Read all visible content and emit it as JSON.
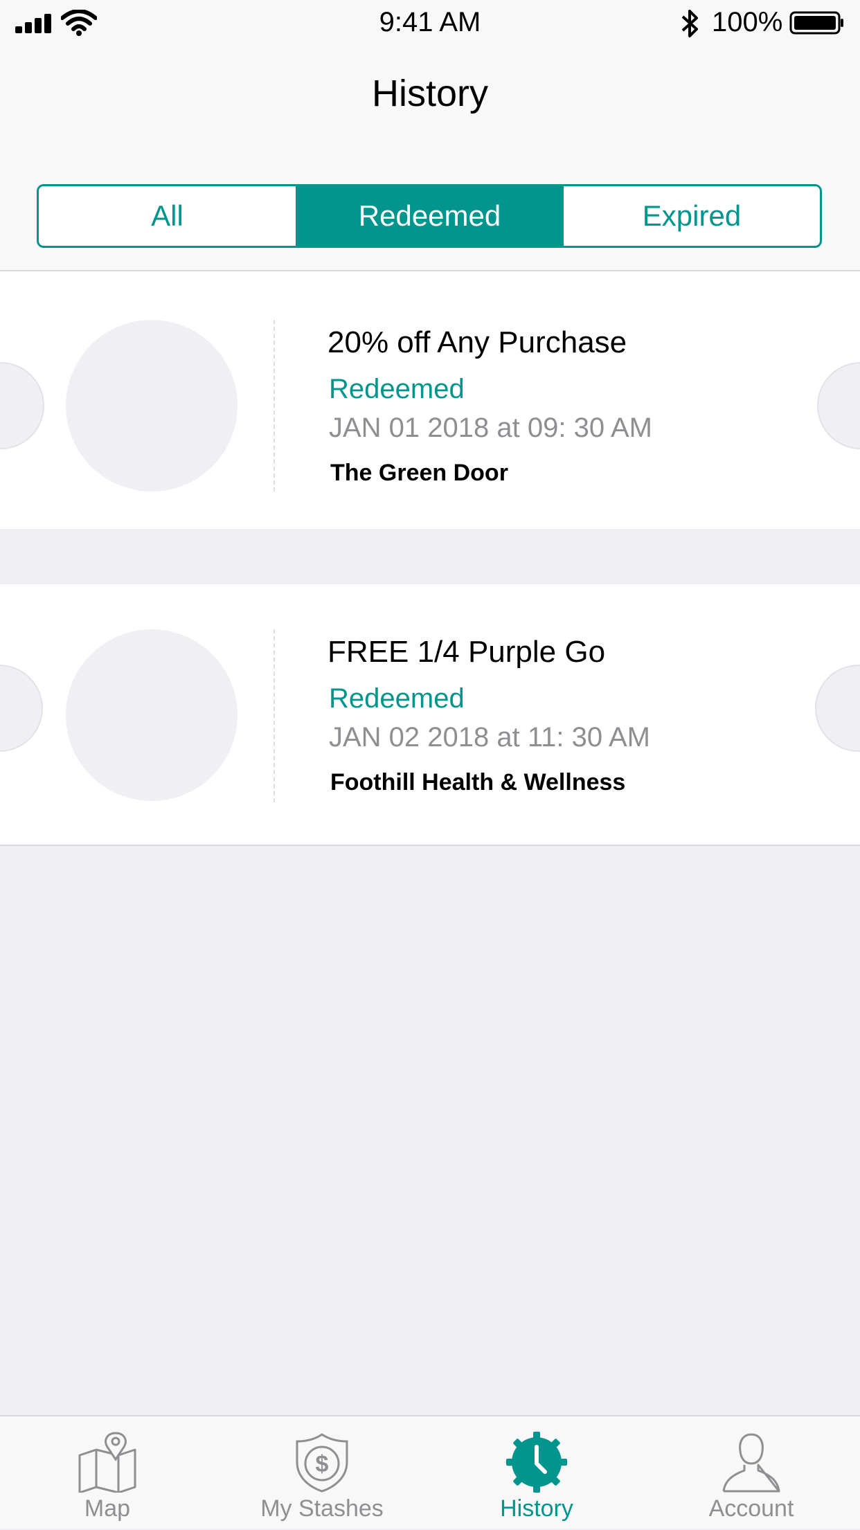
{
  "status_bar": {
    "time": "9:41 AM",
    "battery": "100%"
  },
  "header": {
    "title": "History"
  },
  "segments": [
    {
      "label": "All",
      "active": false
    },
    {
      "label": "Redeemed",
      "active": true
    },
    {
      "label": "Expired",
      "active": false
    }
  ],
  "coupons": [
    {
      "title": "20% off Any Purchase",
      "status": "Redeemed",
      "date": "JAN 01 2018 at 09: 30 AM",
      "store": "The Green Door"
    },
    {
      "title": "FREE 1/4 Purple Go",
      "status": "Redeemed",
      "date": "JAN 02 2018 at 11: 30 AM",
      "store": "Foothill Health & Wellness"
    }
  ],
  "tabs": [
    {
      "label": "Map",
      "icon": "map-icon"
    },
    {
      "label": "My Stashes",
      "icon": "dollar-shield-icon"
    },
    {
      "label": "History",
      "icon": "clock-icon",
      "active": true
    },
    {
      "label": "Account",
      "icon": "person-icon"
    }
  ],
  "colors": {
    "accent": "#01958d",
    "background": "#efeff4",
    "muted_text": "#8e8e93"
  }
}
